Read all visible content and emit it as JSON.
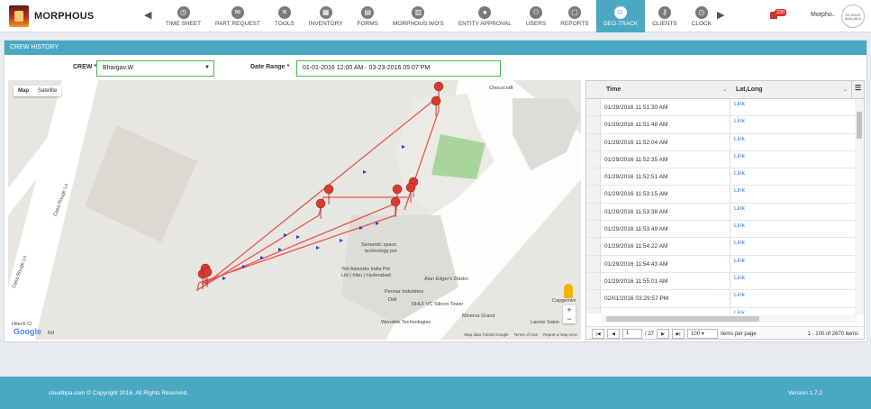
{
  "app": {
    "name": "MORPHOUS"
  },
  "nav": [
    {
      "label": "TIME SHEET",
      "icon": "clock-icon",
      "glyph": "◷"
    },
    {
      "label": "PART REQUEST",
      "icon": "mail-icon",
      "glyph": "✉"
    },
    {
      "label": "TOOLS",
      "icon": "wrench-icon",
      "glyph": "✕"
    },
    {
      "label": "INVENTORY",
      "icon": "cart-icon",
      "glyph": "▦"
    },
    {
      "label": "FORMS",
      "icon": "forms-icon",
      "glyph": "▤"
    },
    {
      "label": "MORPHOUS.WO'S",
      "icon": "workorder-icon",
      "glyph": "▥"
    },
    {
      "label": "ENTITY APPROVAL",
      "icon": "approval-icon",
      "glyph": "●"
    },
    {
      "label": "USERS",
      "icon": "users-icon",
      "glyph": "⚇"
    },
    {
      "label": "REPORTS",
      "icon": "reports-icon",
      "glyph": "▢"
    },
    {
      "label": "GEO-TRACK",
      "icon": "map-pin-icon",
      "glyph": "⊙",
      "active": true
    },
    {
      "label": "CLIENTS",
      "icon": "key-icon",
      "glyph": "⚷"
    },
    {
      "label": "CLOCK",
      "icon": "clock-icon",
      "glyph": "◷"
    }
  ],
  "header": {
    "notification_count": "220",
    "user_name": "Morpho..",
    "avatar_text": "NO IMAGE AVAILABLE"
  },
  "panel": {
    "title": "CREW HISTORY"
  },
  "filters": {
    "crew_label": "CREW *",
    "crew_value": "Bhargav.W",
    "range_label": "Date Range *",
    "range_value": "01-01-2016 12:00 AM - 03-23-2016 05:07 PM"
  },
  "map": {
    "type_map": "Map",
    "type_satellite": "Satellite",
    "labels": {
      "casa_rouge_1": "Casa Rouge Ln",
      "casa_rouge_2": "Casa Rouge Ln",
      "chococraft": "Chococraft",
      "semantic": "Semantic space",
      "semantic2": "technology pvt",
      "yell": "Yell Adworks India Pvt",
      "yell2": "Ltd ( hibu ) Hyderabad",
      "alan": "Alan Edger's Zbisko",
      "pennar": "Pennar Industries",
      "dell": "Dell",
      "dhlf": "DHLF VC Silicon Tower",
      "minerva": "Minerva Grand",
      "wenable": "Wenable Technologies",
      "laxme": "Laxme Salon",
      "capgemini": "Capgemini",
      "hitech": "Hitech Ci",
      "rd": "Rd"
    },
    "google": "Google",
    "footer": [
      "Map data ©2016 Google",
      "Terms of Use",
      "Report a map error"
    ]
  },
  "grid": {
    "col_time": "Time",
    "col_latlong": "Lat,Long",
    "rows": [
      {
        "time": "01/29/2016 11:51:30 AM",
        "link": "Link"
      },
      {
        "time": "01/29/2016 11:51:48 AM",
        "link": "Link"
      },
      {
        "time": "01/29/2016 11:52:04 AM",
        "link": "Link"
      },
      {
        "time": "01/29/2016 11:52:35 AM",
        "link": "Link"
      },
      {
        "time": "01/29/2016 11:52:51 AM",
        "link": "Link"
      },
      {
        "time": "01/29/2016 11:53:15 AM",
        "link": "Link"
      },
      {
        "time": "01/29/2016 11:53:38 AM",
        "link": "Link"
      },
      {
        "time": "01/29/2016 11:53:49 AM",
        "link": "Link"
      },
      {
        "time": "01/29/2016 11:54:22 AM",
        "link": "Link"
      },
      {
        "time": "01/29/2016 11:54:43 AM",
        "link": "Link"
      },
      {
        "time": "01/29/2016 11:55:01 AM",
        "link": "Link"
      },
      {
        "time": "02/01/2016 03:29:57 PM",
        "link": "Link"
      },
      {
        "time": "",
        "link": "Link"
      }
    ],
    "pager": {
      "page": "1",
      "total_pages": "/ 27",
      "page_size": "100",
      "items_per_page": "items per page",
      "info": "1 - 100 of 2670 items"
    }
  },
  "footer": {
    "copyright": "cloudbpa.com © Copyright 2016. All Rights Reserved.",
    "version": "Version 1.7.2"
  }
}
